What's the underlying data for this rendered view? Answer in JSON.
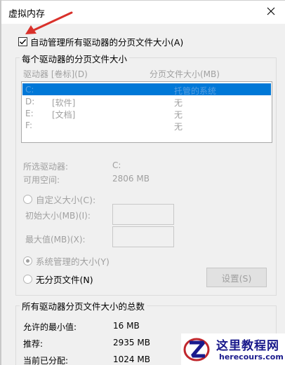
{
  "window": {
    "title": "虚拟内存"
  },
  "auto_manage": {
    "label": "自动管理所有驱动器的分页文件大小(A)",
    "checked": true
  },
  "drives_group": {
    "title": "每个驱动器的分页文件大小",
    "col_drive": "驱动器 [卷标](D)",
    "col_size": "分页文件大小(MB)",
    "rows": [
      {
        "drive": "C:",
        "label": "",
        "size": "托管的系统",
        "selected": true
      },
      {
        "drive": "D:",
        "label": "[软件]",
        "size": "无",
        "selected": false
      },
      {
        "drive": "E:",
        "label": "[文档]",
        "size": "无",
        "selected": false
      },
      {
        "drive": "F:",
        "label": "",
        "size": "无",
        "selected": false
      }
    ],
    "selected_drive_label": "所选驱动器:",
    "selected_drive_value": "C:",
    "free_space_label": "可用空间:",
    "free_space_value": "2806 MB",
    "custom_size_label": "自定义大小(C):",
    "initial_size_label": "初始大小(MB)(I):",
    "max_size_label": "最大值(MB)(X):",
    "system_managed_label": "系统管理的大小(Y)",
    "no_paging_label": "无分页文件(N)",
    "set_button": "设置(S)"
  },
  "totals_group": {
    "title": "所有驱动器分页文件大小的总数",
    "min_label": "允许的最小值:",
    "min_value": "16 MB",
    "recommended_label": "推荐:",
    "recommended_value": "2935 MB",
    "current_label": "当前已分配:",
    "current_value": "1024 MB"
  },
  "watermark": {
    "title": "这里教程网",
    "subtitle": "herecours.com"
  },
  "colors": {
    "selection": "#0078d7",
    "arrow": "#d9312b",
    "disabled_text": "#a0a0a0"
  }
}
